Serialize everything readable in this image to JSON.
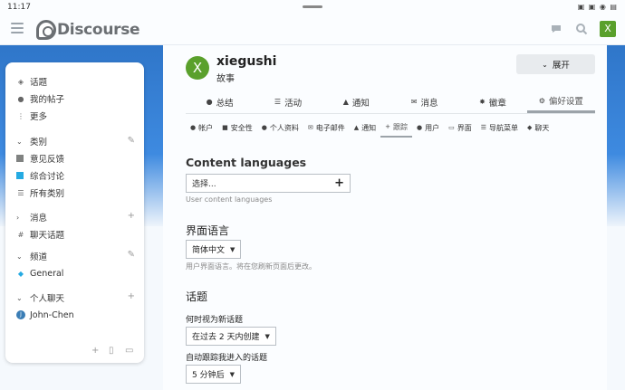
{
  "status": {
    "time": "11:17",
    "system_icons": "▣ ▣ ◉ ▤"
  },
  "header": {
    "logo_text": "Discourse",
    "avatar_letter": "X"
  },
  "sidebar": {
    "top_items": [
      {
        "icon": "layer-icon",
        "label": "话题"
      },
      {
        "icon": "user-icon",
        "label": "我的帖子"
      },
      {
        "icon": "more-icon",
        "label": "更多"
      }
    ],
    "categories": {
      "title": "类别",
      "items": [
        {
          "label": "意见反馈",
          "color": "#808281"
        },
        {
          "label": "综合讨论",
          "color": "#25AAE2"
        },
        {
          "label": "所有类别",
          "color": ""
        }
      ]
    },
    "messages": {
      "title": "消息",
      "items": [
        {
          "label": "聊天话题"
        }
      ]
    },
    "channels": {
      "title": "频道",
      "items": [
        {
          "label": "General"
        }
      ]
    },
    "dm": {
      "title": "个人聊天",
      "items": [
        {
          "label": "John-Chen",
          "avatar": "J"
        }
      ]
    }
  },
  "profile": {
    "avatar_letter": "X",
    "username": "xiegushi",
    "name": "故事",
    "expand_label": "展开"
  },
  "tabs_main": [
    {
      "icon": "summary-icon",
      "label": "总结"
    },
    {
      "icon": "activity-icon",
      "label": "活动"
    },
    {
      "icon": "bell-icon",
      "label": "通知"
    },
    {
      "icon": "envelope-icon",
      "label": "消息"
    },
    {
      "icon": "badge-icon",
      "label": "徽章"
    },
    {
      "icon": "gear-icon",
      "label": "偏好设置"
    }
  ],
  "tabs_sub": [
    {
      "icon": "user-icon",
      "label": "帐户"
    },
    {
      "icon": "lock-icon",
      "label": "安全性"
    },
    {
      "icon": "user-icon",
      "label": "个人资料"
    },
    {
      "icon": "envelope-icon",
      "label": "电子邮件"
    },
    {
      "icon": "bell-icon",
      "label": "通知"
    },
    {
      "icon": "plus-icon",
      "label": "跟踪"
    },
    {
      "icon": "users-icon",
      "label": "用户"
    },
    {
      "icon": "desktop-icon",
      "label": "界面"
    },
    {
      "icon": "nav-icon",
      "label": "导航菜单"
    },
    {
      "icon": "chat-icon",
      "label": "聊天"
    }
  ],
  "content_languages": {
    "title": "Content languages",
    "placeholder": "选择...",
    "hint": "User content languages"
  },
  "interface_language": {
    "title": "界面语言",
    "value": "简体中文",
    "hint": "用户界面语言。将在您刷新页面后更改。"
  },
  "topics": {
    "title": "话题",
    "new_label": "何时视为新话题",
    "new_value": "在过去 2 天内创建",
    "track_label": "自动跟踪我进入的话题",
    "track_value": "5 分钟后"
  }
}
